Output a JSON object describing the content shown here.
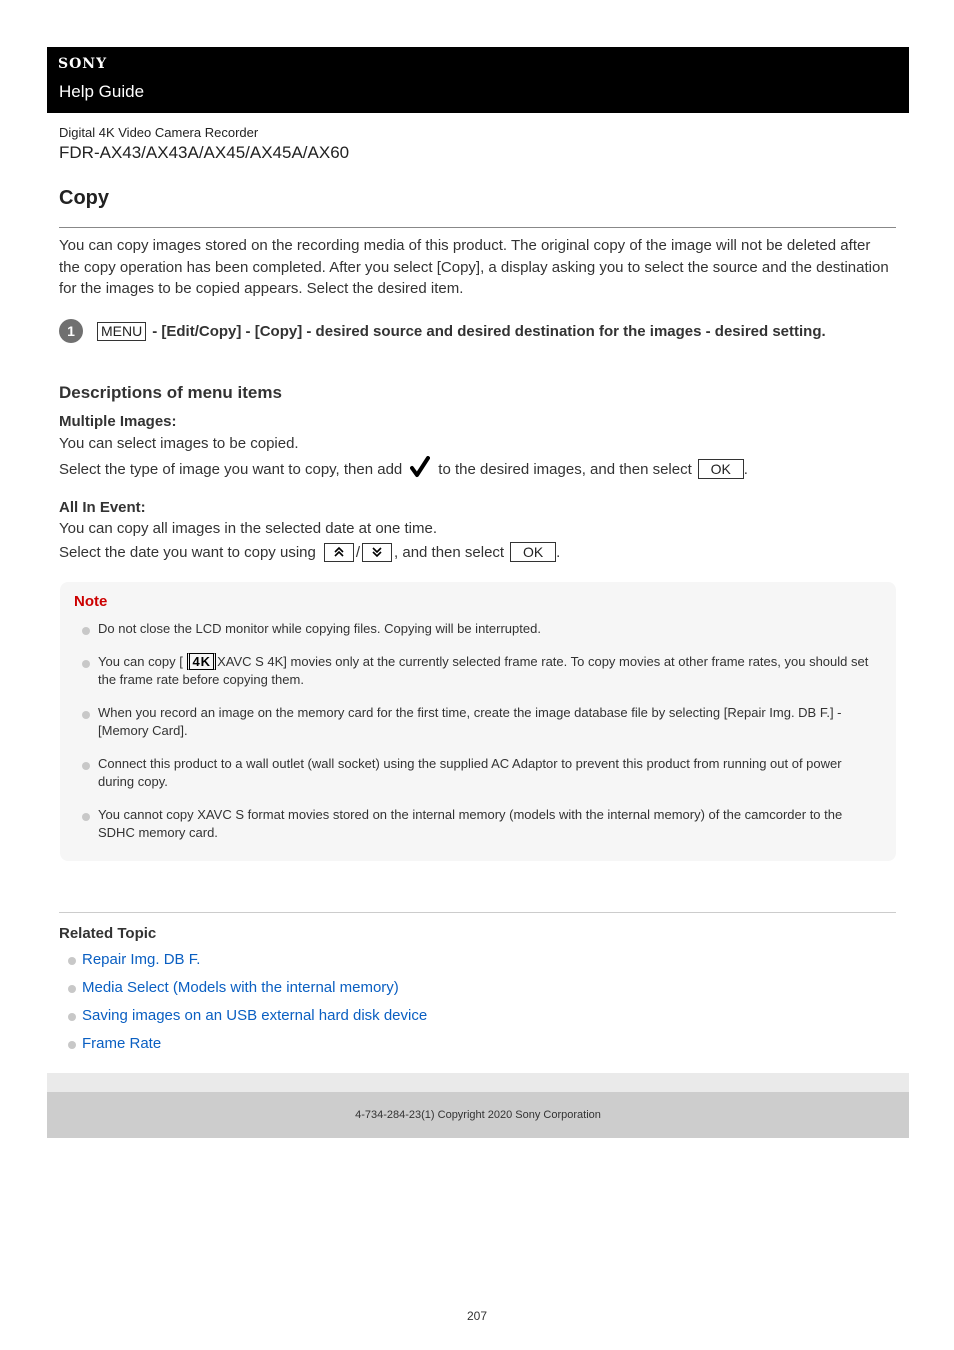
{
  "header": {
    "brand": "SONY",
    "guide_title": "Help Guide"
  },
  "product": {
    "category": "Digital 4K Video Camera Recorder",
    "models": "FDR-AX43/AX43A/AX45/AX45A/AX60"
  },
  "page": {
    "title": "Copy",
    "intro": "You can copy images stored on the recording media of this product. The original copy of the image will not be deleted after the copy operation has been completed. After you select [Copy], a display asking you to select the source and the destination for the images to be copied appears. Select the desired item."
  },
  "step": {
    "number": "1",
    "menu_key": "MENU",
    "text": "- [Edit/Copy] - [Copy] - desired source and desired destination for the images - desired setting."
  },
  "descriptions": {
    "heading": "Descriptions of menu items",
    "multiple_images": {
      "title": "Multiple Images:",
      "line1": "You can select images to be copied.",
      "line2_before": "Select the type of image you want to copy, then add",
      "check_icon": "checkmark-icon",
      "line2_after": "to the desired images, and then select",
      "ok_label": "OK",
      "end": "."
    },
    "all_in_event": {
      "title": "All In Event:",
      "line1": "You can copy all images in the selected date at one time.",
      "line2_before": "Select the date you want to copy using",
      "up_icon": "double-chevron-up-icon",
      "separator": "/",
      "down_icon": "double-chevron-down-icon",
      "line2_after": ", and then select",
      "ok_label": "OK",
      "end": "."
    }
  },
  "note": {
    "title": "Note",
    "items": [
      {
        "text": "Do not close the LCD monitor while copying files. Copying will be interrupted."
      },
      {
        "before": "You can copy [",
        "badge": "4K",
        "after": "XAVC S 4K] movies only at the currently selected frame rate. To copy movies at other frame rates, you should set the frame rate before copying them."
      },
      {
        "text": "When you record an image on the memory card for the first time, create the image database file by selecting [Repair Img. DB F.] - [Memory Card]."
      },
      {
        "text": "Connect this product to a wall outlet (wall socket) using the supplied AC Adaptor to prevent this product from running out of power during copy."
      },
      {
        "text": "You cannot copy XAVC S format movies stored on the internal memory (models with the internal memory) of the camcorder to the SDHC memory card."
      }
    ]
  },
  "related": {
    "title": "Related Topic",
    "links": [
      {
        "label": "Repair Img. DB F."
      },
      {
        "label": "Media Select (Models with the internal memory)"
      },
      {
        "label": "Saving images on an USB external hard disk device"
      },
      {
        "label": "Frame Rate"
      }
    ]
  },
  "footer": {
    "copyright": "4-734-284-23(1) Copyright 2020 Sony Corporation"
  },
  "page_number": "207",
  "colors": {
    "note_title": "#cc0000",
    "link": "#0a5fc2",
    "header_bg": "#000000"
  }
}
